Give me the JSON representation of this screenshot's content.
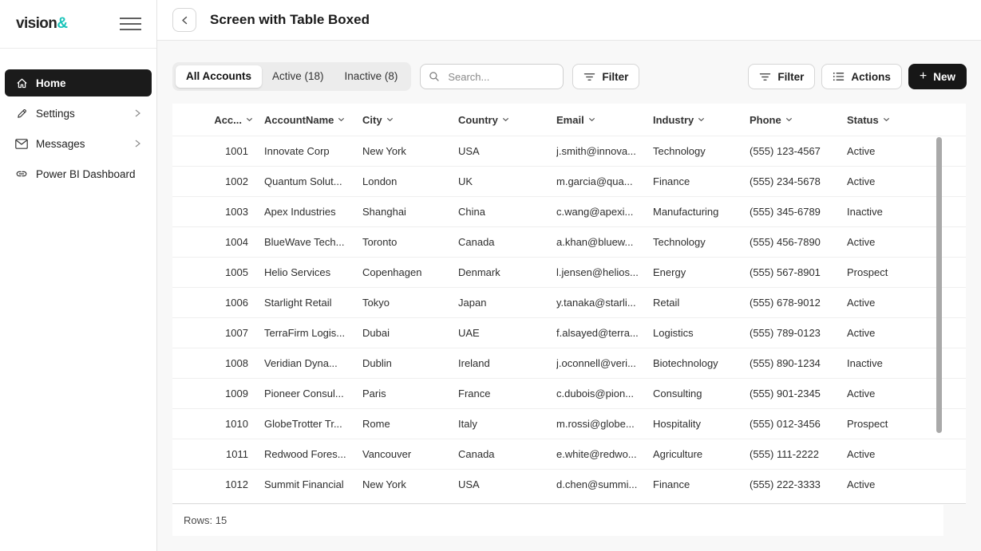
{
  "brand": {
    "name": "vision",
    "accent": "&"
  },
  "sidebar": {
    "items": [
      {
        "label": "Home",
        "icon": "home-icon",
        "active": true,
        "expandable": false
      },
      {
        "label": "Settings",
        "icon": "pencil-icon",
        "active": false,
        "expandable": true
      },
      {
        "label": "Messages",
        "icon": "envelope-icon",
        "active": false,
        "expandable": true
      },
      {
        "label": "Power BI Dashboard",
        "icon": "link-icon",
        "active": false,
        "expandable": false
      }
    ]
  },
  "header": {
    "title": "Screen with Table Boxed"
  },
  "toolbar": {
    "tabs": [
      {
        "label": "All Accounts",
        "active": true
      },
      {
        "label": "Active (18)",
        "active": false
      },
      {
        "label": "Inactive (8)",
        "active": false
      }
    ],
    "search_placeholder": "Search...",
    "filter_left_label": "Filter",
    "filter_right_label": "Filter",
    "actions_label": "Actions",
    "new_label": "New",
    "new_plus": "+"
  },
  "icons": {
    "menu": "hamburger",
    "back": "chevron-left",
    "search": "magnifier",
    "filter": "filter-lines",
    "actions": "bullet-list",
    "new": "plus",
    "sort": "chevron-down",
    "nav_expand": "chevron-right"
  },
  "table": {
    "columns": [
      "Acc...",
      "AccountName",
      "City",
      "Country",
      "Email",
      "Industry",
      "Phone",
      "Status"
    ],
    "rows": [
      {
        "id": "1001",
        "name": "Innovate Corp",
        "city": "New York",
        "country": "USA",
        "email": "j.smith@innova...",
        "industry": "Technology",
        "phone": "(555) 123-4567",
        "status": "Active"
      },
      {
        "id": "1002",
        "name": "Quantum Solut...",
        "city": "London",
        "country": "UK",
        "email": "m.garcia@qua...",
        "industry": "Finance",
        "phone": "(555) 234-5678",
        "status": "Active"
      },
      {
        "id": "1003",
        "name": "Apex Industries",
        "city": "Shanghai",
        "country": "China",
        "email": "c.wang@apexi...",
        "industry": "Manufacturing",
        "phone": "(555) 345-6789",
        "status": "Inactive"
      },
      {
        "id": "1004",
        "name": "BlueWave Tech...",
        "city": "Toronto",
        "country": "Canada",
        "email": "a.khan@bluew...",
        "industry": "Technology",
        "phone": "(555) 456-7890",
        "status": "Active"
      },
      {
        "id": "1005",
        "name": "Helio Services",
        "city": "Copenhagen",
        "country": "Denmark",
        "email": "l.jensen@helios...",
        "industry": "Energy",
        "phone": "(555) 567-8901",
        "status": "Prospect"
      },
      {
        "id": "1006",
        "name": "Starlight Retail",
        "city": "Tokyo",
        "country": "Japan",
        "email": "y.tanaka@starli...",
        "industry": "Retail",
        "phone": "(555) 678-9012",
        "status": "Active"
      },
      {
        "id": "1007",
        "name": "TerraFirm Logis...",
        "city": "Dubai",
        "country": "UAE",
        "email": "f.alsayed@terra...",
        "industry": "Logistics",
        "phone": "(555) 789-0123",
        "status": "Active"
      },
      {
        "id": "1008",
        "name": "Veridian Dyna...",
        "city": "Dublin",
        "country": "Ireland",
        "email": "j.oconnell@veri...",
        "industry": "Biotechnology",
        "phone": "(555) 890-1234",
        "status": "Inactive"
      },
      {
        "id": "1009",
        "name": "Pioneer Consul...",
        "city": "Paris",
        "country": "France",
        "email": "c.dubois@pion...",
        "industry": "Consulting",
        "phone": "(555) 901-2345",
        "status": "Active"
      },
      {
        "id": "1010",
        "name": "GlobeTrotter Tr...",
        "city": "Rome",
        "country": "Italy",
        "email": "m.rossi@globe...",
        "industry": "Hospitality",
        "phone": "(555) 012-3456",
        "status": "Prospect"
      },
      {
        "id": "1011",
        "name": "Redwood Fores...",
        "city": "Vancouver",
        "country": "Canada",
        "email": "e.white@redwo...",
        "industry": "Agriculture",
        "phone": "(555) 111-2222",
        "status": "Active"
      },
      {
        "id": "1012",
        "name": "Summit Financial",
        "city": "New York",
        "country": "USA",
        "email": "d.chen@summi...",
        "industry": "Finance",
        "phone": "(555) 222-3333",
        "status": "Active"
      }
    ]
  },
  "footer": {
    "rows_label": "Rows: 15"
  },
  "colors": {
    "accent_teal": "#1cc4ba",
    "dark": "#1b1b1b",
    "page_bg": "#f8f8f8",
    "row_text": "#2e2e2e"
  }
}
